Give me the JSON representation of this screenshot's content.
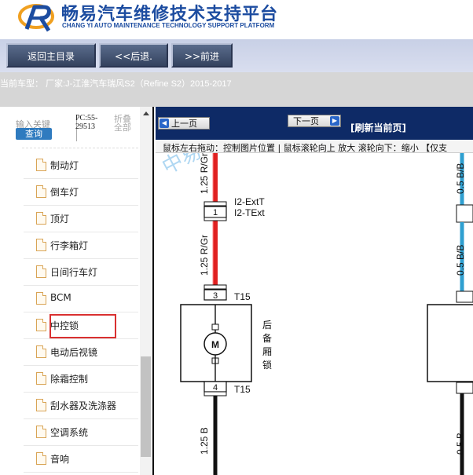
{
  "header": {
    "brand_cn": "畅易汽车维修技术支持平台",
    "brand_en": "CHANG YI AUTO MAINTENANCE TECHNOLOGY SUPPORT PLATFORM"
  },
  "nav": {
    "home": "返回主目录",
    "back": "<<后退.",
    "forward": ">>前进"
  },
  "car_line": "当前车型： 厂家:J-江淮汽车瑞风S2（Refine S2）2015-2017",
  "sidebar": {
    "keyword_label": "输入关键",
    "query": "查询",
    "pc_code": "PC:55-29513",
    "fold": "折叠全部",
    "items": [
      {
        "label": "制动灯"
      },
      {
        "label": "倒车灯"
      },
      {
        "label": "顶灯"
      },
      {
        "label": "行李箱灯"
      },
      {
        "label": "日间行车灯"
      },
      {
        "label": "BCM"
      },
      {
        "label": "中控锁"
      },
      {
        "label": "电动后视镜"
      },
      {
        "label": "除霜控制"
      },
      {
        "label": "刮水器及洗涤器"
      },
      {
        "label": "空调系统"
      },
      {
        "label": "音响"
      }
    ],
    "selected": "中控锁"
  },
  "viewer": {
    "prev": "上一页",
    "next": "下一页",
    "refresh": "[刷新当前页]",
    "hint": "鼠标左右拖动：控制图片位置 | 鼠标滚轮向上 放大  滚轮向下：缩小 【仅支"
  },
  "diagram": {
    "wire_top_left": "1.25 R/Gr",
    "wire_mid_left": "1.25 R/Gr",
    "wire_bottom_left": "1.25 B",
    "wire_top_right": "0.5 B/B",
    "wire_mid_right": "0.5 B/B",
    "wire_bottom_right": "0.5 B",
    "conn1_pin": "1",
    "conn1_name_a": "I2-ExtT",
    "conn1_name_b": "I2-TExt",
    "pin3": "3",
    "pin4": "4",
    "t15_top": "T15",
    "t15_bottom": "T15",
    "motor": "M",
    "component": [
      "后",
      "备",
      "厢",
      "锁"
    ],
    "watermark": "中易"
  },
  "colors": {
    "brand": "#1c4ca0",
    "toolbar": "#0e2a66",
    "wire_red": "#e02020",
    "highlight": "#d93030"
  }
}
